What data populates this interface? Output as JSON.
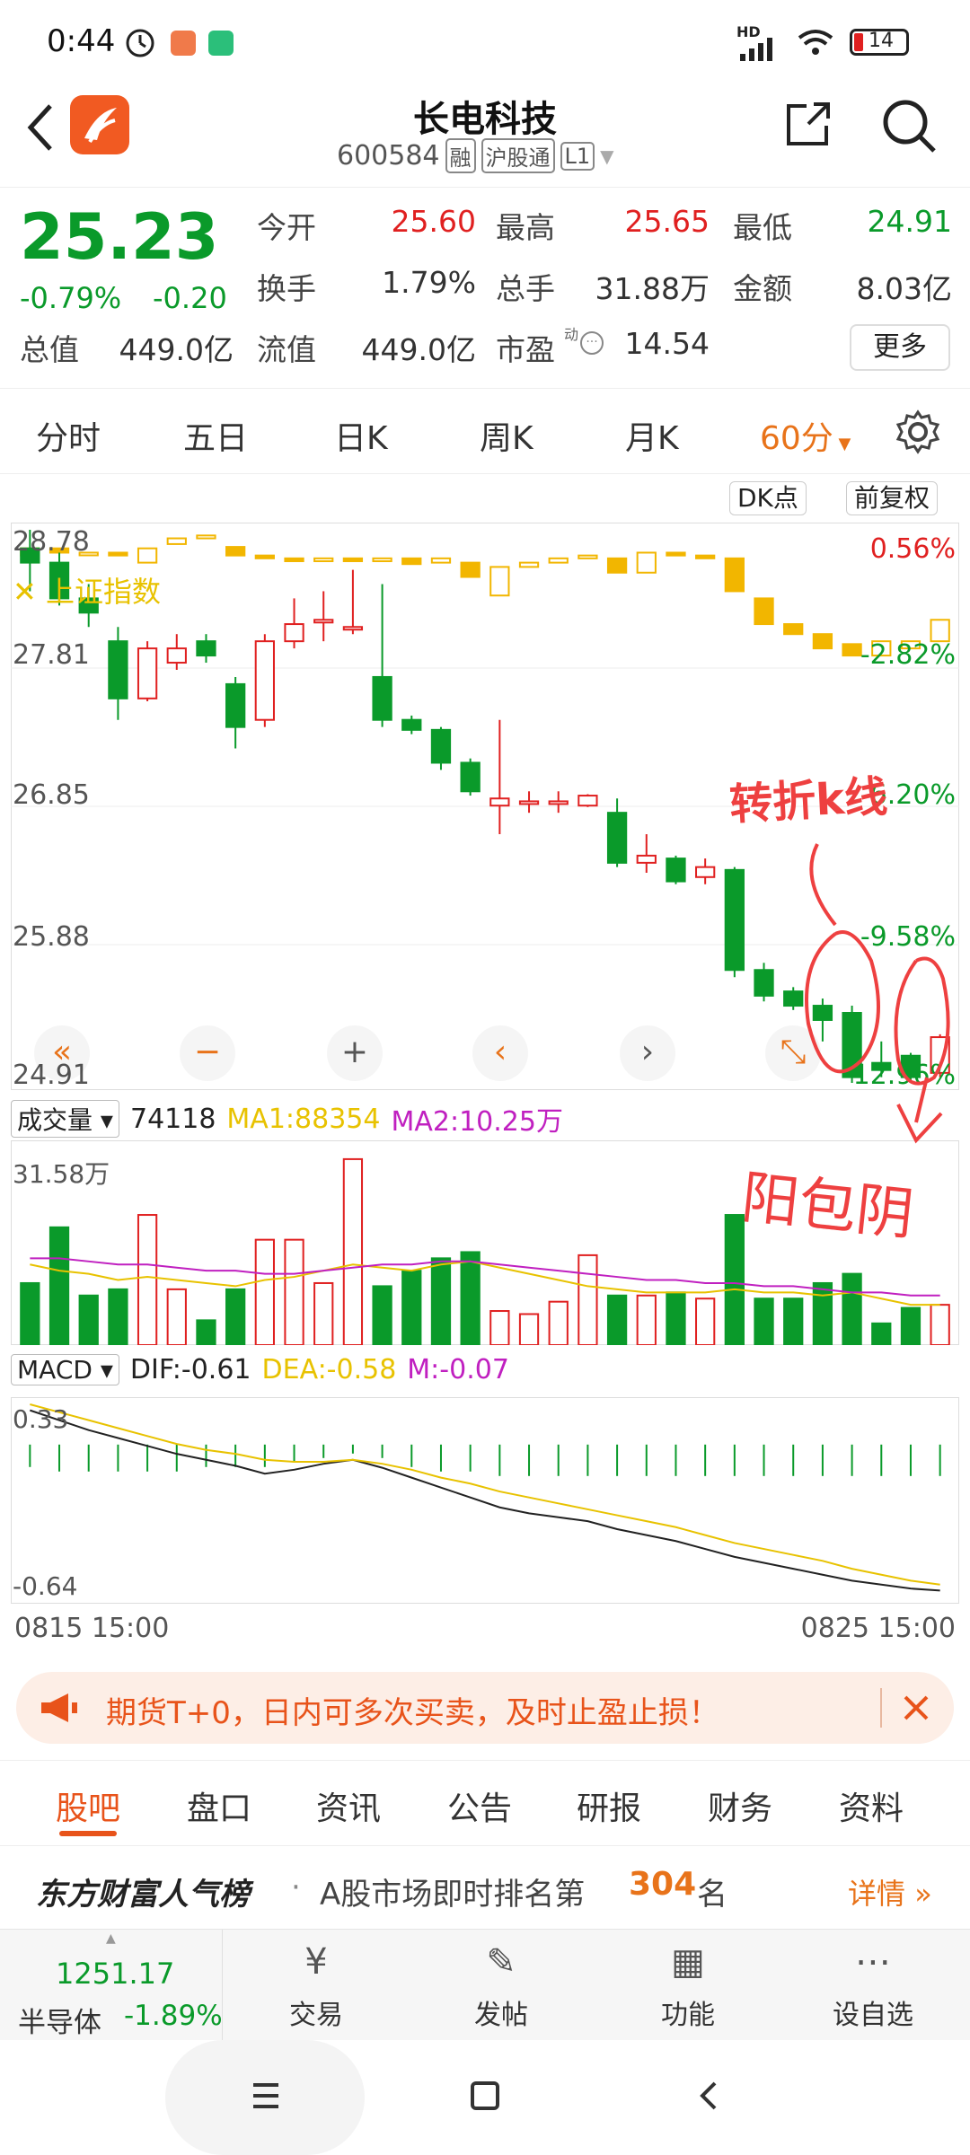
{
  "status_bar": {
    "time": "0:44",
    "network": "HD",
    "battery": "14"
  },
  "header": {
    "title": "长电科技",
    "code": "600584",
    "tags": [
      "融",
      "沪股通",
      "L1"
    ]
  },
  "quote": {
    "price": "25.23",
    "change_pct": "-0.79%",
    "change": "-0.20",
    "fields": [
      {
        "label": "今开",
        "value": "25.60",
        "color": "red"
      },
      {
        "label": "最高",
        "value": "25.65",
        "color": "red"
      },
      {
        "label": "最低",
        "value": "24.91",
        "color": "green"
      },
      {
        "label": "换手",
        "value": "1.79%",
        "color": "gray"
      },
      {
        "label": "总手",
        "value": "31.88万",
        "color": "gray"
      },
      {
        "label": "金额",
        "value": "8.03亿",
        "color": "gray"
      },
      {
        "label": "总值",
        "value": "449.0亿",
        "color": "gray"
      },
      {
        "label": "流值",
        "value": "449.0亿",
        "color": "gray"
      },
      {
        "label": "市盈",
        "value": "14.54",
        "color": "gray"
      }
    ],
    "pe_superscript": "动",
    "more_label": "更多"
  },
  "period_tabs": [
    "分时",
    "五日",
    "日K",
    "周K",
    "月K",
    "60分"
  ],
  "active_period": "60分",
  "chart_buttons": {
    "dk": "DK点",
    "adjust": "前复权"
  },
  "chart_data": {
    "type": "candlestick",
    "price_axis": [
      "28.78",
      "27.81",
      "26.85",
      "25.88",
      "24.91"
    ],
    "pct_axis": [
      "0.56%",
      "-2.82%",
      "-6.20%",
      "-9.58%",
      "-12.96%"
    ],
    "overlay_label": "上证指数",
    "candles": [
      {
        "o": 28.65,
        "c": 28.55,
        "h": 28.78,
        "l": 28.35
      },
      {
        "o": 28.55,
        "c": 28.3,
        "h": 28.62,
        "l": 28.25
      },
      {
        "o": 28.3,
        "c": 28.2,
        "h": 28.4,
        "l": 28.1
      },
      {
        "o": 28.0,
        "c": 27.6,
        "h": 28.1,
        "l": 27.45
      },
      {
        "o": 27.6,
        "c": 27.95,
        "h": 28.0,
        "l": 27.58
      },
      {
        "o": 27.85,
        "c": 27.95,
        "h": 28.05,
        "l": 27.8
      },
      {
        "o": 28.0,
        "c": 27.9,
        "h": 28.05,
        "l": 27.85
      },
      {
        "o": 27.7,
        "c": 27.4,
        "h": 27.75,
        "l": 27.25
      },
      {
        "o": 27.45,
        "c": 28.0,
        "h": 28.05,
        "l": 27.4
      },
      {
        "o": 28.0,
        "c": 28.12,
        "h": 28.3,
        "l": 27.95
      },
      {
        "o": 28.15,
        "c": 28.15,
        "h": 28.35,
        "l": 28.0
      },
      {
        "o": 28.1,
        "c": 28.1,
        "h": 28.5,
        "l": 28.05
      },
      {
        "o": 27.75,
        "c": 27.45,
        "h": 28.4,
        "l": 27.4
      },
      {
        "o": 27.45,
        "c": 27.38,
        "h": 27.48,
        "l": 27.35
      },
      {
        "o": 27.38,
        "c": 27.15,
        "h": 27.4,
        "l": 27.1
      },
      {
        "o": 27.15,
        "c": 26.95,
        "h": 27.18,
        "l": 26.92
      },
      {
        "o": 26.85,
        "c": 26.9,
        "h": 27.45,
        "l": 26.65
      },
      {
        "o": 26.88,
        "c": 26.88,
        "h": 26.95,
        "l": 26.8
      },
      {
        "o": 26.88,
        "c": 26.88,
        "h": 26.95,
        "l": 26.8
      },
      {
        "o": 26.85,
        "c": 26.92,
        "h": 26.93,
        "l": 26.84
      },
      {
        "o": 26.8,
        "c": 26.45,
        "h": 26.9,
        "l": 26.42
      },
      {
        "o": 26.45,
        "c": 26.5,
        "h": 26.65,
        "l": 26.38
      },
      {
        "o": 26.48,
        "c": 26.32,
        "h": 26.5,
        "l": 26.3
      },
      {
        "o": 26.35,
        "c": 26.42,
        "h": 26.48,
        "l": 26.3
      },
      {
        "o": 26.4,
        "c": 25.7,
        "h": 26.42,
        "l": 25.65
      },
      {
        "o": 25.7,
        "c": 25.52,
        "h": 25.75,
        "l": 25.48
      },
      {
        "o": 25.55,
        "c": 25.45,
        "h": 25.58,
        "l": 25.42
      },
      {
        "o": 25.45,
        "c": 25.35,
        "h": 25.5,
        "l": 25.2
      },
      {
        "o": 25.4,
        "c": 24.95,
        "h": 25.45,
        "l": 24.91
      },
      {
        "o": 25.05,
        "c": 25.0,
        "h": 25.2,
        "l": 24.95
      },
      {
        "o": 25.1,
        "c": 24.95,
        "h": 25.12,
        "l": 24.91
      },
      {
        "o": 24.98,
        "c": 25.23,
        "h": 25.25,
        "l": 24.95
      }
    ],
    "index_candles": [
      {
        "o": 28.6,
        "c": 28.65
      },
      {
        "o": 28.65,
        "c": 28.62
      },
      {
        "o": 28.62,
        "c": 28.62
      },
      {
        "o": 28.62,
        "c": 28.6
      },
      {
        "o": 28.55,
        "c": 28.65
      },
      {
        "o": 28.68,
        "c": 28.72
      },
      {
        "o": 28.72,
        "c": 28.74
      },
      {
        "o": 28.66,
        "c": 28.6
      },
      {
        "o": 28.6,
        "c": 28.58
      },
      {
        "o": 28.58,
        "c": 28.56
      },
      {
        "o": 28.56,
        "c": 28.58
      },
      {
        "o": 28.58,
        "c": 28.56
      },
      {
        "o": 28.56,
        "c": 28.58
      },
      {
        "o": 28.58,
        "c": 28.54
      },
      {
        "o": 28.55,
        "c": 28.58
      },
      {
        "o": 28.55,
        "c": 28.45
      },
      {
        "o": 28.32,
        "c": 28.52
      },
      {
        "o": 28.52,
        "c": 28.55
      },
      {
        "o": 28.55,
        "c": 28.58
      },
      {
        "o": 28.58,
        "c": 28.6
      },
      {
        "o": 28.58,
        "c": 28.48
      },
      {
        "o": 28.48,
        "c": 28.62
      },
      {
        "o": 28.62,
        "c": 28.6
      },
      {
        "o": 28.6,
        "c": 28.58
      },
      {
        "o": 28.58,
        "c": 28.35
      },
      {
        "o": 28.3,
        "c": 28.12
      },
      {
        "o": 28.12,
        "c": 28.05
      },
      {
        "o": 28.05,
        "c": 27.95
      },
      {
        "o": 27.98,
        "c": 27.9
      },
      {
        "o": 27.9,
        "c": 28.0
      },
      {
        "o": 27.95,
        "c": 28.0
      },
      {
        "o": 28.0,
        "c": 28.15
      }
    ],
    "volume_max_label": "31.58万",
    "volumes": [
      1.0,
      1.9,
      0.8,
      0.9,
      2.1,
      0.9,
      0.4,
      0.9,
      1.7,
      1.7,
      1.0,
      3.0,
      0.95,
      1.2,
      1.4,
      1.5,
      0.55,
      0.5,
      0.7,
      1.45,
      0.8,
      0.8,
      0.85,
      0.75,
      2.1,
      0.75,
      0.75,
      1.0,
      1.15,
      0.35,
      0.6,
      0.65
    ],
    "ma1": [
      1.3,
      1.2,
      1.15,
      1.05,
      1.1,
      1.05,
      1.0,
      0.95,
      1.05,
      1.1,
      1.2,
      1.3,
      1.25,
      1.2,
      1.3,
      1.35,
      1.25,
      1.15,
      1.05,
      0.95,
      0.9,
      0.85,
      0.85,
      0.85,
      0.9,
      0.85,
      0.85,
      0.8,
      0.85,
      0.75,
      0.65,
      0.65
    ],
    "ma2": [
      1.4,
      1.4,
      1.35,
      1.3,
      1.3,
      1.25,
      1.2,
      1.2,
      1.15,
      1.15,
      1.2,
      1.25,
      1.3,
      1.3,
      1.35,
      1.35,
      1.3,
      1.25,
      1.2,
      1.15,
      1.1,
      1.05,
      1.05,
      1.0,
      1.0,
      0.95,
      0.95,
      0.9,
      0.85,
      0.85,
      0.8,
      0.8
    ],
    "volume_header": {
      "selector": "成交量",
      "value": "74118",
      "ma1": "MA1:88354",
      "ma2": "MA2:10.25万"
    },
    "macd_header": {
      "selector": "MACD",
      "dif": "DIF:-0.61",
      "dea": "DEA:-0.58",
      "m": "M:-0.07"
    },
    "macd_axis": [
      "0.33",
      "-0.64"
    ],
    "dif": [
      0.3,
      0.25,
      0.2,
      0.16,
      0.12,
      0.08,
      0.05,
      0.02,
      -0.02,
      0.0,
      0.03,
      0.05,
      0.01,
      -0.04,
      -0.09,
      -0.14,
      -0.19,
      -0.22,
      -0.24,
      -0.26,
      -0.3,
      -0.33,
      -0.36,
      -0.4,
      -0.44,
      -0.47,
      -0.5,
      -0.53,
      -0.56,
      -0.58,
      -0.6,
      -0.61
    ],
    "dea": [
      0.33,
      0.29,
      0.25,
      0.21,
      0.17,
      0.13,
      0.1,
      0.08,
      0.05,
      0.04,
      0.04,
      0.05,
      0.03,
      0.0,
      -0.04,
      -0.07,
      -0.11,
      -0.14,
      -0.17,
      -0.2,
      -0.23,
      -0.26,
      -0.29,
      -0.33,
      -0.37,
      -0.4,
      -0.43,
      -0.46,
      -0.5,
      -0.53,
      -0.56,
      -0.58
    ],
    "macd_m": [
      -0.05,
      -0.06,
      -0.06,
      -0.06,
      -0.06,
      -0.06,
      -0.05,
      -0.05,
      -0.05,
      -0.04,
      -0.03,
      -0.02,
      -0.03,
      -0.05,
      -0.06,
      -0.06,
      -0.07,
      -0.07,
      -0.07,
      -0.07,
      -0.07,
      -0.07,
      -0.07,
      -0.07,
      -0.07,
      -0.07,
      -0.07,
      -0.07,
      -0.07,
      -0.07,
      -0.07,
      -0.07
    ],
    "time_axis": [
      "0815 15:00",
      "0825 15:00"
    ]
  },
  "annotations": {
    "turning_k": "转折k线",
    "engulf": "阳包阴"
  },
  "colors": {
    "up": "#e02020",
    "down": "#0a9a2a",
    "index": "#f2b600",
    "accent": "#e8731a",
    "dif": "#222222",
    "dea": "#e8c200",
    "ma1": "#e8c200",
    "ma2": "#c020c0"
  },
  "banner": {
    "text": "期货T+0，日内可多次买卖，及时止盈止损！"
  },
  "bottom_tabs": [
    "股吧",
    "盘口",
    "资讯",
    "公告",
    "研报",
    "财务",
    "资料"
  ],
  "rank": {
    "title": "东方财富人气榜",
    "text": "A股市场即时排名第",
    "number": "304",
    "suffix": "名",
    "detail": "详情"
  },
  "dock": {
    "index_value": "1251.17",
    "index_name": "半导体",
    "index_change": "-1.89%",
    "items": [
      {
        "label": "交易",
        "icon": "yen-icon"
      },
      {
        "label": "发帖",
        "icon": "edit-icon"
      },
      {
        "label": "功能",
        "icon": "grid-icon"
      },
      {
        "label": "设自选",
        "icon": "more-icon"
      }
    ]
  }
}
